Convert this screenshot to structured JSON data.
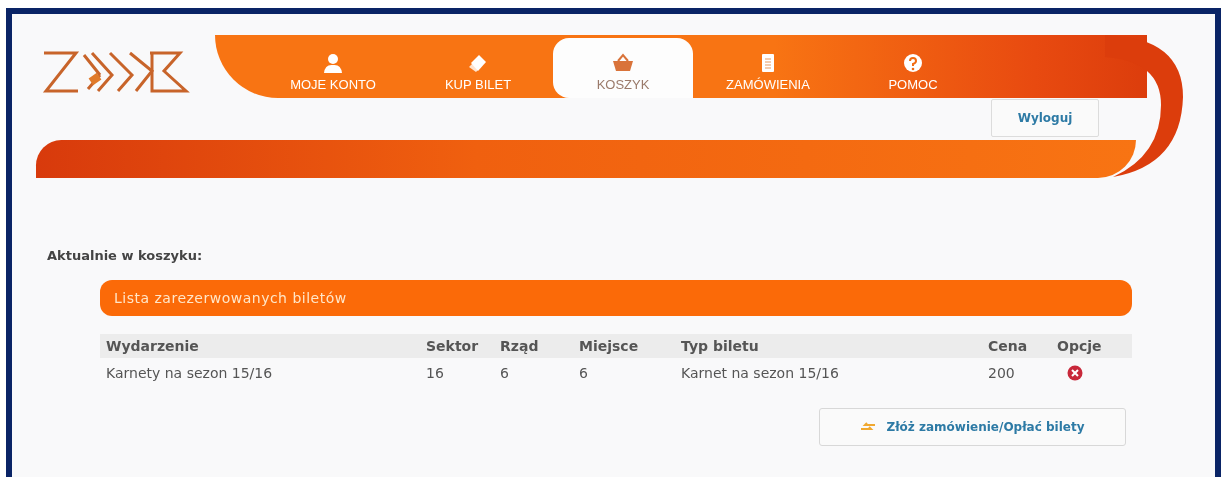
{
  "nav": [
    {
      "label": "MOJE KONTO",
      "selected": false
    },
    {
      "label": "KUP BILET",
      "selected": false
    },
    {
      "label": "KOSZYK",
      "selected": true
    },
    {
      "label": "ZAMÓWIENIA",
      "selected": false
    },
    {
      "label": "POMOC",
      "selected": false
    }
  ],
  "logout_button": "Wyloguj",
  "heading": "Aktualnie w koszyku:",
  "panel_title": "Lista zarezerwowanych biletów",
  "table": {
    "columns": [
      "Wydarzenie",
      "Sektor",
      "Rząd",
      "Miejsce",
      "Typ biletu",
      "Cena",
      "Opcje"
    ],
    "rows": [
      {
        "cells": [
          "Karnety na sezon 15/16",
          "16",
          "6",
          "6",
          "Karnet na sezon 15/16",
          "200"
        ]
      }
    ]
  },
  "order_button": "Złóż zamówienie/Opłać bilety"
}
